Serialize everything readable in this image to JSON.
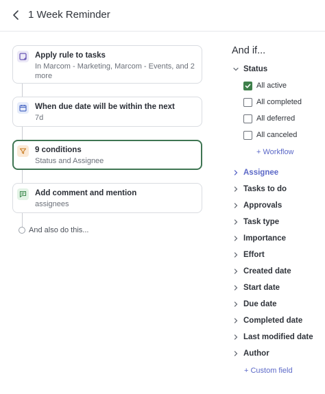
{
  "header": {
    "title": "1 Week Reminder"
  },
  "steps": [
    {
      "title": "Apply rule to tasks",
      "subtitle": "In Marcom - Marketing, Marcom - Events, and 2 more",
      "icon": "tasks-icon"
    },
    {
      "title": "When due date will be within the next",
      "subtitle": "7d",
      "icon": "calendar-icon"
    },
    {
      "title": "9 conditions",
      "subtitle": "Status and Assignee",
      "icon": "filter-icon"
    },
    {
      "title": "Add comment and mention",
      "subtitle": "assignees",
      "icon": "comment-icon"
    }
  ],
  "also_label": "And also do this...",
  "conditions": {
    "heading": "And if...",
    "status_label": "Status",
    "status_options": [
      {
        "label": "All active",
        "checked": true
      },
      {
        "label": "All completed",
        "checked": false
      },
      {
        "label": "All deferred",
        "checked": false
      },
      {
        "label": "All canceled",
        "checked": false
      }
    ],
    "workflow_link": "+ Workflow",
    "fields": [
      "Assignee",
      "Tasks to do",
      "Approvals",
      "Task type",
      "Importance",
      "Effort",
      "Created date",
      "Start date",
      "Due date",
      "Completed date",
      "Last modified date",
      "Author"
    ],
    "custom_field_link": "+ Custom field"
  },
  "colors": {
    "accent": "#5b68c7",
    "active_border": "#3e7552",
    "checkbox_on": "#3e7f4a"
  }
}
